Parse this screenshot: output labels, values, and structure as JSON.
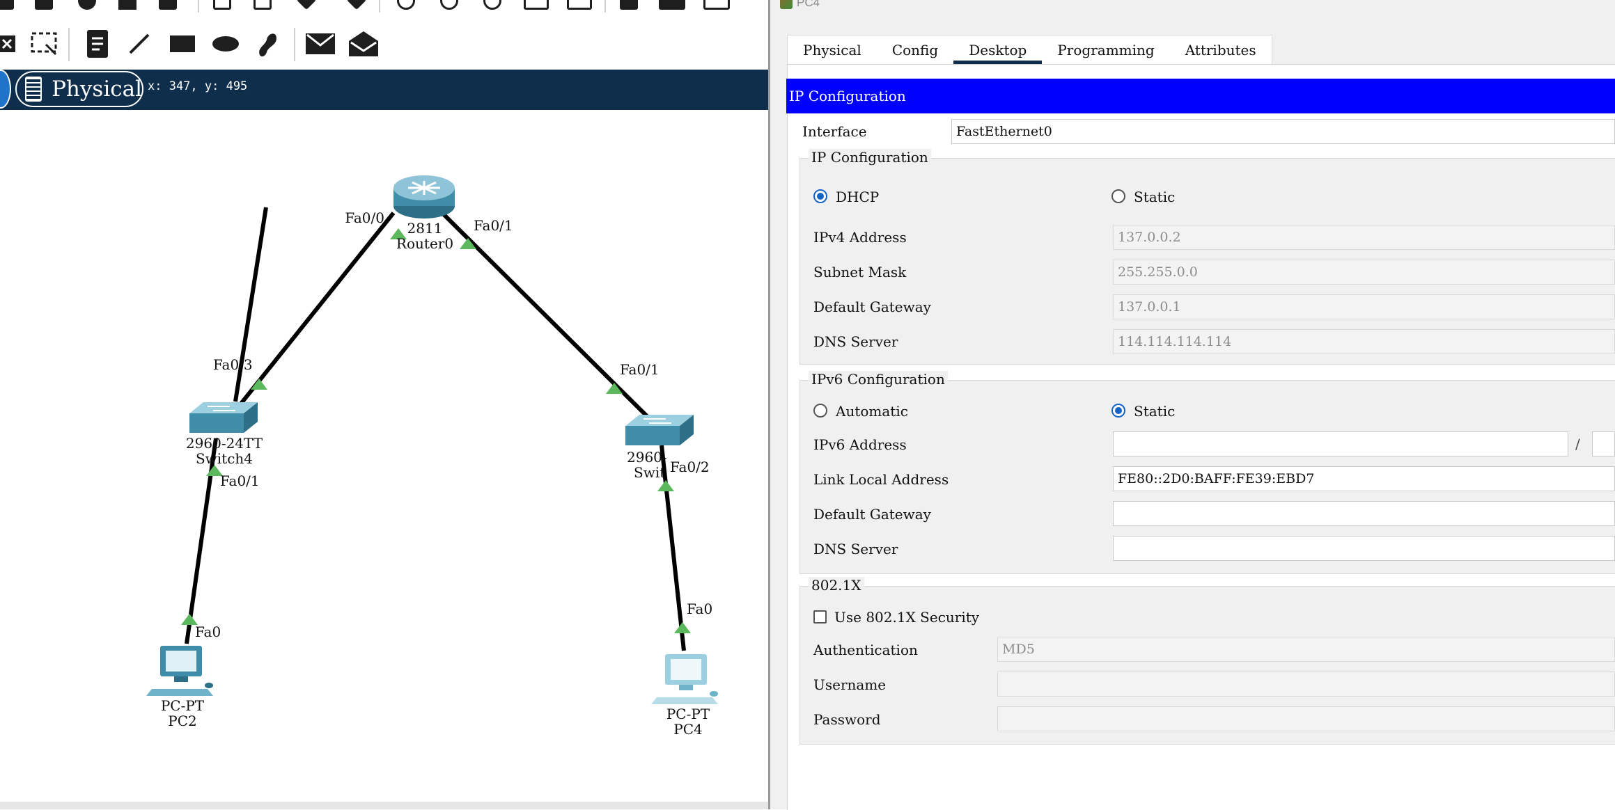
{
  "workspace": {
    "mode_label": "Physical",
    "cursor_coords": "x: 347, y: 495"
  },
  "topology": {
    "router": {
      "model": "2811",
      "name": "Router0",
      "ports": [
        "Fa0/0",
        "Fa0/1"
      ]
    },
    "switch_left": {
      "model": "2960-24TT",
      "name": "Switch4",
      "ports": [
        "Fa0/3",
        "Fa0/1"
      ]
    },
    "switch_right": {
      "model": "2960-24TT",
      "name": "Swit",
      "model_partial": "2960-",
      "ports": [
        "Fa0/1",
        "Fa0/2"
      ]
    },
    "pc_left": {
      "model": "PC-PT",
      "name": "PC2",
      "port": "Fa0"
    },
    "pc_right": {
      "model": "PC-PT",
      "name": "PC4",
      "port": "Fa0"
    }
  },
  "dialog": {
    "title": "PC4",
    "tabs": [
      {
        "label": "Physical",
        "active": false
      },
      {
        "label": "Config",
        "active": false
      },
      {
        "label": "Desktop",
        "active": true
      },
      {
        "label": "Programming",
        "active": false
      },
      {
        "label": "Attributes",
        "active": false
      }
    ],
    "section_title": "IP Configuration",
    "interface_label": "Interface",
    "interface_value": "FastEthernet0",
    "ipv4": {
      "group_title": "IP Configuration",
      "dhcp_label": "DHCP",
      "static_label": "Static",
      "selected": "DHCP",
      "ipv4_label": "IPv4 Address",
      "ipv4_value": "137.0.0.2",
      "mask_label": "Subnet Mask",
      "mask_value": "255.255.0.0",
      "gateway_label": "Default Gateway",
      "gateway_value": "137.0.0.1",
      "dns_label": "DNS Server",
      "dns_value": "114.114.114.114"
    },
    "ipv6": {
      "group_title": "IPv6 Configuration",
      "auto_label": "Automatic",
      "static_label": "Static",
      "selected": "Static",
      "address_label": "IPv6 Address",
      "address_value": "",
      "prefix_sep": "/",
      "link_local_label": "Link Local Address",
      "link_local_value": "FE80::2D0:BAFF:FE39:EBD7",
      "gateway_label": "Default Gateway",
      "gateway_value": "",
      "dns_label": "DNS Server",
      "dns_value": ""
    },
    "dot1x": {
      "group_title": "802.1X",
      "use_label": "Use 802.1X Security",
      "use_checked": false,
      "auth_label": "Authentication",
      "auth_value": "MD5",
      "username_label": "Username",
      "username_value": "",
      "password_label": "Password",
      "password_value": ""
    }
  },
  "colors": {
    "mode_bar": "#0f2e4c",
    "section_header": "#0000ff",
    "link": "#000000",
    "port_up": "#5cb85c",
    "device": "#4a9ab5",
    "radio_selected": "#1464c8"
  }
}
